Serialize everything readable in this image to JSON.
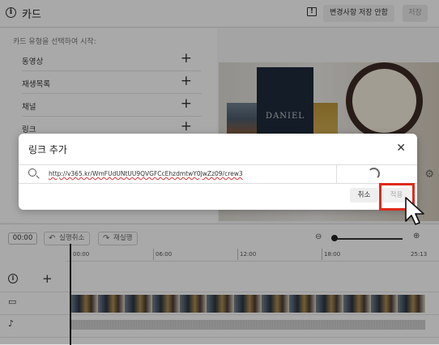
{
  "topbar": {
    "title": "카드",
    "discard_label": "변경사항 저장 안함",
    "save_label": "저장"
  },
  "cards_panel": {
    "prompt": "카드 유형을 선택하여 시작:",
    "items": [
      {
        "label": "동영상"
      },
      {
        "label": "재생목록"
      },
      {
        "label": "채널"
      },
      {
        "label": "링크"
      }
    ]
  },
  "preview": {
    "box_text": "DANIEL"
  },
  "dialog": {
    "title": "링크 추가",
    "url_value": "http://v365.kr/WmFUdUNtUU9QVGFCcEhzdmtwY0JwZz09/crew3",
    "cancel_label": "취소",
    "apply_label": "적용"
  },
  "timeline": {
    "current_time": "00:00",
    "undo_label": "실행취소",
    "redo_label": "재실행",
    "ruler_ticks": [
      "00:00",
      "06:00",
      "12:00",
      "18:00",
      "25:13"
    ],
    "zoom_level": 0.0
  },
  "colors": {
    "highlight": "#e02a1b",
    "overlay": "rgba(0,0,0,0.32)"
  }
}
